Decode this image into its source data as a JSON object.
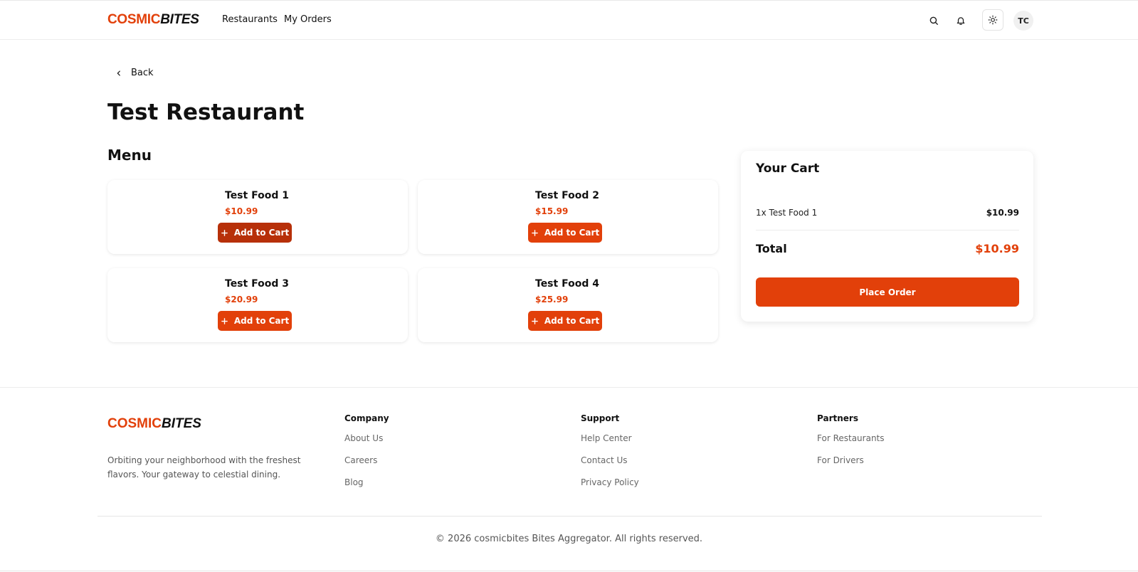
{
  "header": {
    "logo_part1": "COSMIC",
    "logo_part2": "BITES",
    "nav": [
      {
        "label": "Restaurants"
      },
      {
        "label": "My Orders"
      }
    ],
    "avatar_initials": "TC",
    "icons": [
      "search-icon",
      "bell-icon",
      "sun-icon"
    ]
  },
  "main": {
    "back_label": "Back",
    "restaurant_name": "Test Restaurant",
    "menu_title": "Menu",
    "foods": [
      {
        "name": "Test Food 1",
        "price": "$10.99",
        "button": "Add to Cart"
      },
      {
        "name": "Test Food 2",
        "price": "$15.99",
        "button": "Add to Cart"
      },
      {
        "name": "Test Food 3",
        "price": "$20.99",
        "button": "Add to Cart"
      },
      {
        "name": "Test Food 4",
        "price": "$25.99",
        "button": "Add to Cart"
      }
    ]
  },
  "cart": {
    "title": "Your Cart",
    "items": [
      {
        "label": "1x Test Food 1",
        "price": "$10.99"
      }
    ],
    "total_label": "Total",
    "total_value": "$10.99",
    "place_order": "Place Order"
  },
  "footer": {
    "logo_part1": "COSMIC",
    "logo_part2": "BITES",
    "tagline": "Orbiting your neighborhood with the freshest flavors. Your gateway to celestial dining.",
    "columns": [
      {
        "title": "Company",
        "links": [
          "About Us",
          "Careers",
          "Blog"
        ]
      },
      {
        "title": "Support",
        "links": [
          "Help Center",
          "Contact Us",
          "Privacy Policy"
        ]
      },
      {
        "title": "Partners",
        "links": [
          "For Restaurants",
          "For Drivers"
        ]
      }
    ],
    "copyright": "© 2026 cosmicbites Bites Aggregator. All rights reserved."
  },
  "colors": {
    "accent": "#e2400a",
    "accent_pressed": "#b73009",
    "text": "#111111"
  }
}
